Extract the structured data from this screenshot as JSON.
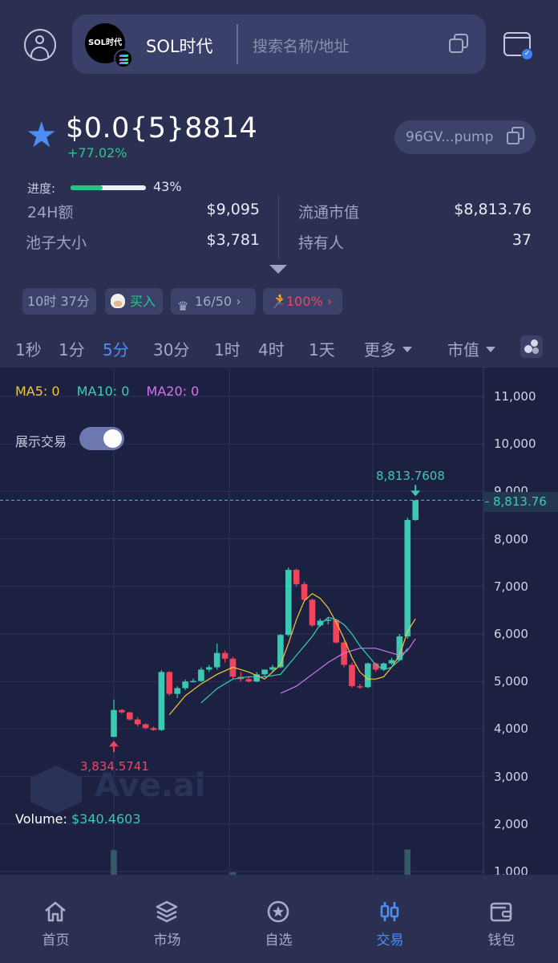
{
  "header": {
    "token_logo_text": "SOL时代",
    "token_name": "SOL时代",
    "search_placeholder": "搜索名称/地址"
  },
  "token": {
    "price": "$0.0{5}8814",
    "change": "+77.02%",
    "address": "96GV...pump",
    "progress_label": "进度:",
    "progress_pct_text": "43%",
    "progress_fraction": 0.43,
    "stats": {
      "volume_24h_label": "24H额",
      "volume_24h_value": "$9,095",
      "pool_label": "池子大小",
      "pool_value": "$3,781",
      "mcap_label": "流通市值",
      "mcap_value": "$8,813.76",
      "holders_label": "持有人",
      "holders_value": "37"
    },
    "tags": {
      "age": "10时 37分",
      "buy": "买入",
      "top": "16/50",
      "runner": "100%"
    }
  },
  "intervals": {
    "tabs": [
      "1秒",
      "1分",
      "5分",
      "30分",
      "1时",
      "4时",
      "1天"
    ],
    "active": "5分",
    "more_label": "更多",
    "mode_label": "市值"
  },
  "chart": {
    "ma5_label": "MA5: 0",
    "ma10_label": "MA10: 0",
    "ma20_label": "MA20: 0",
    "show_trades_label": "展示交易",
    "show_trades_on": true,
    "y_ticks": [
      "11,000",
      "10,000",
      "9,000",
      "8,000",
      "7,000",
      "6,000",
      "5,000",
      "4,000",
      "3,000",
      "2,000",
      "1,000"
    ],
    "last_price_tag": "8,813.76",
    "high_label": "8,813.7608",
    "low_label": "3,834.5741",
    "volume_label_prefix": "Volume:",
    "volume_value": "$340.4603",
    "watermark_text": "Ave.ai",
    "colors": {
      "up": "#3bc9b2",
      "down": "#f3445e",
      "ma5": "#f2c634",
      "ma10": "#36d1b0",
      "ma20": "#d773f0"
    }
  },
  "chart_data": {
    "type": "candlestick",
    "ylim": [
      1000,
      11000
    ],
    "y_unit": "market cap (USD)",
    "candles": [
      {
        "o": 3834,
        "h": 4620,
        "l": 3834,
        "c": 4400
      },
      {
        "o": 4400,
        "h": 4420,
        "l": 4320,
        "c": 4350
      },
      {
        "o": 4350,
        "h": 4360,
        "l": 4180,
        "c": 4200
      },
      {
        "o": 4200,
        "h": 4250,
        "l": 4050,
        "c": 4100
      },
      {
        "o": 4100,
        "h": 4120,
        "l": 4000,
        "c": 4020
      },
      {
        "o": 4020,
        "h": 4050,
        "l": 3960,
        "c": 3980
      },
      {
        "o": 3980,
        "h": 5240,
        "l": 3960,
        "c": 5200
      },
      {
        "o": 5200,
        "h": 5220,
        "l": 4700,
        "c": 4740
      },
      {
        "o": 4740,
        "h": 4900,
        "l": 4650,
        "c": 4860
      },
      {
        "o": 4860,
        "h": 5040,
        "l": 4820,
        "c": 5000
      },
      {
        "o": 5000,
        "h": 5060,
        "l": 4980,
        "c": 5010
      },
      {
        "o": 5010,
        "h": 5300,
        "l": 4990,
        "c": 5250
      },
      {
        "o": 5250,
        "h": 5350,
        "l": 5200,
        "c": 5300
      },
      {
        "o": 5300,
        "h": 5800,
        "l": 5250,
        "c": 5600
      },
      {
        "o": 5600,
        "h": 5650,
        "l": 5400,
        "c": 5480
      },
      {
        "o": 5480,
        "h": 5520,
        "l": 5050,
        "c": 5100
      },
      {
        "o": 5100,
        "h": 5200,
        "l": 5000,
        "c": 5050
      },
      {
        "o": 5050,
        "h": 5100,
        "l": 4980,
        "c": 5000
      },
      {
        "o": 5000,
        "h": 5200,
        "l": 4980,
        "c": 5150
      },
      {
        "o": 5150,
        "h": 5250,
        "l": 5100,
        "c": 5250
      },
      {
        "o": 5250,
        "h": 5350,
        "l": 5200,
        "c": 5300
      },
      {
        "o": 5300,
        "h": 6000,
        "l": 5280,
        "c": 5980
      },
      {
        "o": 5980,
        "h": 7400,
        "l": 5950,
        "c": 7350
      },
      {
        "o": 7350,
        "h": 7380,
        "l": 7000,
        "c": 7050
      },
      {
        "o": 7050,
        "h": 7100,
        "l": 6700,
        "c": 6720
      },
      {
        "o": 6720,
        "h": 6750,
        "l": 6150,
        "c": 6180
      },
      {
        "o": 6180,
        "h": 6320,
        "l": 6150,
        "c": 6280
      },
      {
        "o": 6280,
        "h": 6340,
        "l": 6200,
        "c": 6300
      },
      {
        "o": 6300,
        "h": 6320,
        "l": 5800,
        "c": 5820
      },
      {
        "o": 5820,
        "h": 5850,
        "l": 5300,
        "c": 5350
      },
      {
        "o": 5350,
        "h": 5400,
        "l": 4870,
        "c": 4900
      },
      {
        "o": 4900,
        "h": 4950,
        "l": 4850,
        "c": 4880
      },
      {
        "o": 4880,
        "h": 5400,
        "l": 4860,
        "c": 5380
      },
      {
        "o": 5380,
        "h": 5400,
        "l": 5200,
        "c": 5250
      },
      {
        "o": 5250,
        "h": 5400,
        "l": 5220,
        "c": 5380
      },
      {
        "o": 5380,
        "h": 5500,
        "l": 5350,
        "c": 5450
      },
      {
        "o": 5450,
        "h": 6000,
        "l": 5430,
        "c": 5950
      },
      {
        "o": 5950,
        "h": 8450,
        "l": 5900,
        "c": 8400
      },
      {
        "o": 8400,
        "h": 8813.76,
        "l": 8380,
        "c": 8813.76
      }
    ],
    "ma5": [
      [
        7,
        4300
      ],
      [
        9,
        4700
      ],
      [
        11,
        4950
      ],
      [
        13,
        5150
      ],
      [
        15,
        5300
      ],
      [
        17,
        5200
      ],
      [
        19,
        5050
      ],
      [
        21,
        5350
      ],
      [
        22,
        5800
      ],
      [
        23,
        6300
      ],
      [
        24,
        6700
      ],
      [
        25,
        6850
      ],
      [
        26,
        6750
      ],
      [
        27,
        6550
      ],
      [
        28,
        6250
      ],
      [
        29,
        5900
      ],
      [
        30,
        5500
      ],
      [
        31,
        5200
      ],
      [
        32,
        5050
      ],
      [
        33,
        5050
      ],
      [
        34,
        5100
      ],
      [
        35,
        5300
      ],
      [
        36,
        5550
      ],
      [
        37,
        6050
      ],
      [
        38,
        6320
      ]
    ],
    "ma10": [
      [
        11,
        4550
      ],
      [
        13,
        4850
      ],
      [
        15,
        5050
      ],
      [
        17,
        5100
      ],
      [
        19,
        5100
      ],
      [
        21,
        5150
      ],
      [
        23,
        5550
      ],
      [
        25,
        5950
      ],
      [
        26,
        6200
      ],
      [
        27,
        6350
      ],
      [
        28,
        6300
      ],
      [
        29,
        6200
      ],
      [
        30,
        6000
      ],
      [
        31,
        5750
      ],
      [
        32,
        5550
      ],
      [
        33,
        5350
      ],
      [
        34,
        5250
      ],
      [
        35,
        5300
      ],
      [
        36,
        5450
      ],
      [
        37,
        5700
      ]
    ],
    "ma20": [
      [
        21,
        4750
      ],
      [
        23,
        4900
      ],
      [
        25,
        5150
      ],
      [
        27,
        5400
      ],
      [
        29,
        5600
      ],
      [
        31,
        5700
      ],
      [
        33,
        5700
      ],
      [
        35,
        5600
      ],
      [
        36,
        5550
      ],
      [
        37,
        5650
      ],
      [
        38,
        5900
      ]
    ],
    "volume": [
      {
        "index": 0,
        "value": 340.4603
      },
      {
        "index": 15,
        "value": 20
      },
      {
        "index": 37,
        "value": 350
      }
    ]
  },
  "nav": {
    "items": [
      {
        "label": "首页",
        "icon": "home-icon"
      },
      {
        "label": "市场",
        "icon": "layers-icon"
      },
      {
        "label": "自选",
        "icon": "star-circle-icon"
      },
      {
        "label": "交易",
        "icon": "candles-icon"
      },
      {
        "label": "钱包",
        "icon": "wallet-icon"
      }
    ],
    "active": "交易"
  }
}
